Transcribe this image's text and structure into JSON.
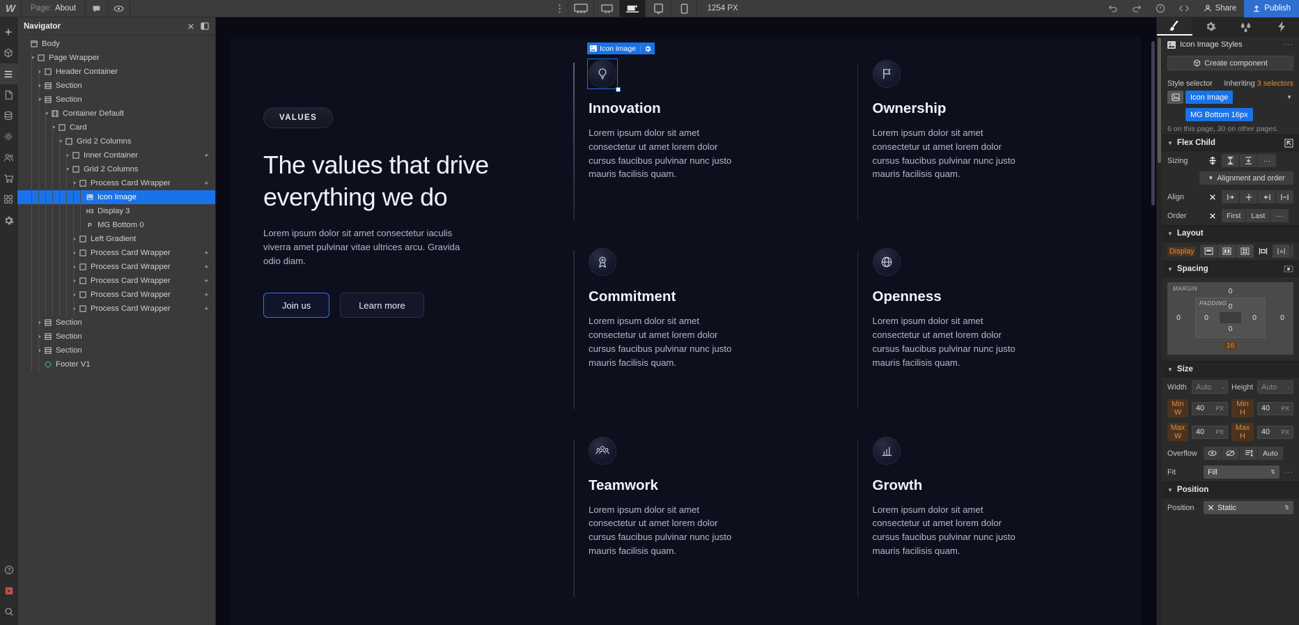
{
  "topbar": {
    "logo": "W",
    "page_label": "Page:",
    "page_name": "About",
    "viewport_px": "1254 PX",
    "share_label": "Share",
    "publish_label": "Publish",
    "icons": {
      "comment": "comment-icon",
      "preview": "eye-icon",
      "undo": "undo-icon",
      "redo": "redo-icon",
      "audit": "audit-icon",
      "code": "code-icon",
      "person": "person-icon",
      "rocket": "rocket-icon",
      "dots": "vertical-dots-icon"
    },
    "viewports": [
      {
        "name": "desktop-large",
        "active": false
      },
      {
        "name": "desktop",
        "active": false
      },
      {
        "name": "laptop-new",
        "active": true
      },
      {
        "name": "tablet",
        "active": false
      },
      {
        "name": "mobile",
        "active": false
      }
    ]
  },
  "rail": {
    "items": [
      {
        "name": "add-panel",
        "glyph": "+"
      },
      {
        "name": "components-panel",
        "glyph": "box"
      },
      {
        "name": "navigator-panel",
        "glyph": "layers",
        "selected": true
      },
      {
        "name": "pages-panel",
        "glyph": "page"
      },
      {
        "name": "cms-panel",
        "glyph": "database"
      },
      {
        "name": "assets-panel",
        "glyph": "assets"
      },
      {
        "name": "users-panel",
        "glyph": "users"
      },
      {
        "name": "ecommerce-panel",
        "glyph": "cart"
      },
      {
        "name": "apps-panel",
        "glyph": "apps"
      },
      {
        "name": "settings-panel",
        "glyph": "gear"
      }
    ],
    "bottom": [
      {
        "name": "help-icon",
        "glyph": "?"
      },
      {
        "name": "video-icon",
        "glyph": "video"
      },
      {
        "name": "search-icon",
        "glyph": "search"
      }
    ]
  },
  "navigator": {
    "title": "Navigator",
    "close_icon": "close-icon",
    "panel_icon": "panel-toggle-icon",
    "tree": [
      {
        "label": "Body",
        "depth": 0,
        "twisty": "none",
        "icon": "body",
        "selected": false,
        "star": false
      },
      {
        "label": "Page Wrapper",
        "depth": 1,
        "twisty": "open",
        "icon": "div",
        "selected": false,
        "star": false
      },
      {
        "label": "Header Container",
        "depth": 2,
        "twisty": "closed",
        "icon": "div",
        "selected": false,
        "star": false
      },
      {
        "label": "Section",
        "depth": 2,
        "twisty": "closed",
        "icon": "section",
        "selected": false,
        "star": false
      },
      {
        "label": "Section",
        "depth": 2,
        "twisty": "open",
        "icon": "section",
        "selected": false,
        "star": false
      },
      {
        "label": "Container Default",
        "depth": 3,
        "twisty": "open",
        "icon": "container",
        "selected": false,
        "star": false
      },
      {
        "label": "Card",
        "depth": 4,
        "twisty": "open",
        "icon": "div",
        "selected": false,
        "star": false
      },
      {
        "label": "Grid 2 Columns",
        "depth": 5,
        "twisty": "open",
        "icon": "div",
        "selected": false,
        "star": false
      },
      {
        "label": "Inner Container",
        "depth": 6,
        "twisty": "closed",
        "icon": "div",
        "selected": false,
        "star": true
      },
      {
        "label": "Grid 2 Columns",
        "depth": 6,
        "twisty": "open",
        "icon": "div",
        "selected": false,
        "star": false
      },
      {
        "label": "Process Card Wrapper",
        "depth": 7,
        "twisty": "open",
        "icon": "div",
        "selected": false,
        "star": true
      },
      {
        "label": "Icon Image",
        "depth": 8,
        "twisty": "none",
        "icon": "image",
        "selected": true,
        "star": false
      },
      {
        "label": "Display 3",
        "depth": 8,
        "twisty": "none",
        "icon": "h3",
        "selected": false,
        "star": false
      },
      {
        "label": "MG Bottom 0",
        "depth": 8,
        "twisty": "none",
        "icon": "p",
        "selected": false,
        "star": false
      },
      {
        "label": "Left Gradient",
        "depth": 7,
        "twisty": "closed",
        "icon": "div",
        "selected": false,
        "star": false
      },
      {
        "label": "Process Card Wrapper",
        "depth": 7,
        "twisty": "closed",
        "icon": "div",
        "selected": false,
        "star": true
      },
      {
        "label": "Process Card Wrapper",
        "depth": 7,
        "twisty": "closed",
        "icon": "div",
        "selected": false,
        "star": true
      },
      {
        "label": "Process Card Wrapper",
        "depth": 7,
        "twisty": "closed",
        "icon": "div",
        "selected": false,
        "star": true
      },
      {
        "label": "Process Card Wrapper",
        "depth": 7,
        "twisty": "closed",
        "icon": "div",
        "selected": false,
        "star": true
      },
      {
        "label": "Process Card Wrapper",
        "depth": 7,
        "twisty": "closed",
        "icon": "div",
        "selected": false,
        "star": true
      },
      {
        "label": "Section",
        "depth": 2,
        "twisty": "closed",
        "icon": "section",
        "selected": false,
        "star": false
      },
      {
        "label": "Section",
        "depth": 2,
        "twisty": "closed",
        "icon": "section",
        "selected": false,
        "star": false
      },
      {
        "label": "Section",
        "depth": 2,
        "twisty": "closed",
        "icon": "section",
        "selected": false,
        "star": false
      },
      {
        "label": "Footer V1",
        "depth": 2,
        "twisty": "none",
        "icon": "component",
        "selected": false,
        "star": false
      }
    ]
  },
  "canvas": {
    "selection_label": "Icon Image",
    "selection_gear_icon": "gear-icon",
    "eyebrow": "VALUES",
    "heading": "The values that drive everything we do",
    "lead": "Lorem ipsum dolor sit amet consectetur iaculis viverra amet pulvinar vitae ultrices arcu. Gravida odio diam.",
    "primary_button": "Join us",
    "secondary_button": "Learn more",
    "body_text": "Lorem ipsum dolor sit amet consectetur ut amet lorem dolor cursus faucibus pulvinar nunc justo mauris facilisis quam.",
    "cards": [
      {
        "title": "Innovation",
        "icon": "lightbulb-icon",
        "selected": true
      },
      {
        "title": "Ownership",
        "icon": "flag-icon",
        "selected": false
      },
      {
        "title": "Commitment",
        "icon": "medal-icon",
        "selected": false
      },
      {
        "title": "Openness",
        "icon": "globe-icon",
        "selected": false
      },
      {
        "title": "Teamwork",
        "icon": "people-icon",
        "selected": false
      },
      {
        "title": "Growth",
        "icon": "bar-chart-icon",
        "selected": false
      }
    ]
  },
  "inspector": {
    "tabs": [
      {
        "name": "style-tab",
        "icon": "brush-icon",
        "active": true
      },
      {
        "name": "settings-tab",
        "icon": "gear-icon",
        "active": false
      },
      {
        "name": "interactions-tab",
        "icon": "droplets-icon",
        "active": false
      },
      {
        "name": "effects-tab",
        "icon": "bolt-icon",
        "active": false
      }
    ],
    "title": "Icon Image Styles",
    "title_icon": "image-icon",
    "overflow_icon": "more-icon",
    "create_component": "Create component",
    "create_component_icon": "component-icon",
    "style_selector_label": "Style selector",
    "inheriting_prefix": "Inheriting",
    "inheriting_value": "3 selectors",
    "chip_primary": "Icon Image",
    "chip_secondary": "MG Bottom 16px",
    "usage_note": "6 on this page, 30 on other pages.",
    "sections": {
      "flex_child": {
        "title": "Flex Child",
        "sizing_label": "Sizing",
        "sizing_options": [
          "shrink-if-needed",
          "grow-if-possible",
          "dont-shrink",
          "more"
        ],
        "alignment_and_order": "Alignment and order",
        "align_label": "Align",
        "align_options": [
          "none",
          "start",
          "center",
          "end",
          "stretch",
          "baseline"
        ],
        "order_label": "Order",
        "order_options": [
          "none",
          "First",
          "Last",
          "more"
        ]
      },
      "layout": {
        "title": "Layout",
        "display_label": "Display",
        "display_options": [
          "block",
          "flex",
          "grid",
          "inline-block",
          "inline",
          "none"
        ]
      },
      "spacing": {
        "title": "Spacing",
        "margin_label": "MARGIN",
        "padding_label": "PADDING",
        "margin_top": "0",
        "margin_right": "0",
        "margin_bottom": "16",
        "margin_left": "0",
        "padding_top": "0",
        "padding_right": "0",
        "padding_bottom": "0",
        "padding_left": "0"
      },
      "size": {
        "title": "Size",
        "width_label": "Width",
        "width_value": "Auto",
        "width_unit": "-",
        "height_label": "Height",
        "height_value": "Auto",
        "height_unit": "-",
        "min_w_label": "Min W",
        "min_w_value": "40",
        "min_w_unit": "PX",
        "min_h_label": "Min H",
        "min_h_value": "40",
        "min_h_unit": "PX",
        "max_w_label": "Max W",
        "max_w_value": "40",
        "max_w_unit": "PX",
        "max_h_label": "Max H",
        "max_h_value": "40",
        "max_h_unit": "PX",
        "overflow_label": "Overflow",
        "overflow_options": [
          "visible",
          "hidden",
          "scroll",
          "Auto"
        ],
        "fit_label": "Fit",
        "fit_value": "Fill"
      },
      "position": {
        "title": "Position",
        "position_label": "Position",
        "position_value": "Static"
      }
    }
  }
}
